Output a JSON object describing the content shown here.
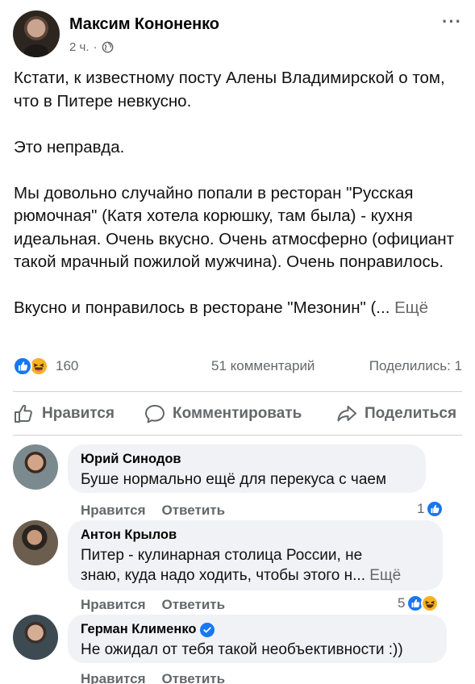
{
  "post": {
    "author": "Максим Кононенко",
    "time": "2 ч.",
    "meta_separator": "·",
    "more_label": "···",
    "paragraphs": [
      "Кстати, к известному посту Алены Владимирской о том, что в Питере невкусно.",
      "Это неправда.",
      "Мы довольно случайно попали в ресторан \"Русская рюмочная\" (Катя хотела корюшку, там была) - кухня идеальная. Очень вкусно. Очень атмосферно (официант такой мрачный пожилой мужчина). Очень понравилось."
    ],
    "last_line": "Вкусно и понравилось в ресторане \"Мезонин\" (...",
    "see_more": "Ещё"
  },
  "stats": {
    "reactions_count": "160",
    "reaction_types": [
      "like-icon",
      "haha-icon"
    ],
    "comments": "51 комментарий",
    "shares": "Поделились: 1"
  },
  "actions": {
    "like": "Нравится",
    "comment": "Комментировать",
    "share": "Поделиться"
  },
  "comments": [
    {
      "name": "Юрий Синодов",
      "text": "Буше нормально ещё для перекуса с чаем",
      "like": "Нравится",
      "reply": "Ответить",
      "reactions": "1",
      "reaction_types": [
        "like-icon"
      ]
    },
    {
      "name": "Антон Крылов",
      "text_line1": "Питер - кулинарная столица России, не",
      "text_line2": "знаю, куда надо ходить, чтобы этого н...",
      "see_more": "Ещё",
      "like": "Нравится",
      "reply": "Ответить",
      "reactions": "5",
      "reaction_types": [
        "like-icon",
        "haha-icon"
      ]
    },
    {
      "name": "Герман Клименко",
      "verified": true,
      "text": "Не ожидал от тебя такой необъективности :))",
      "like": "Нравится",
      "reply": "Ответить"
    }
  ],
  "colors": {
    "like_blue": "#1877f2",
    "haha_yellow": "#f7b125",
    "secondary_text": "#65676b",
    "bubble_bg": "#f0f2f5"
  }
}
